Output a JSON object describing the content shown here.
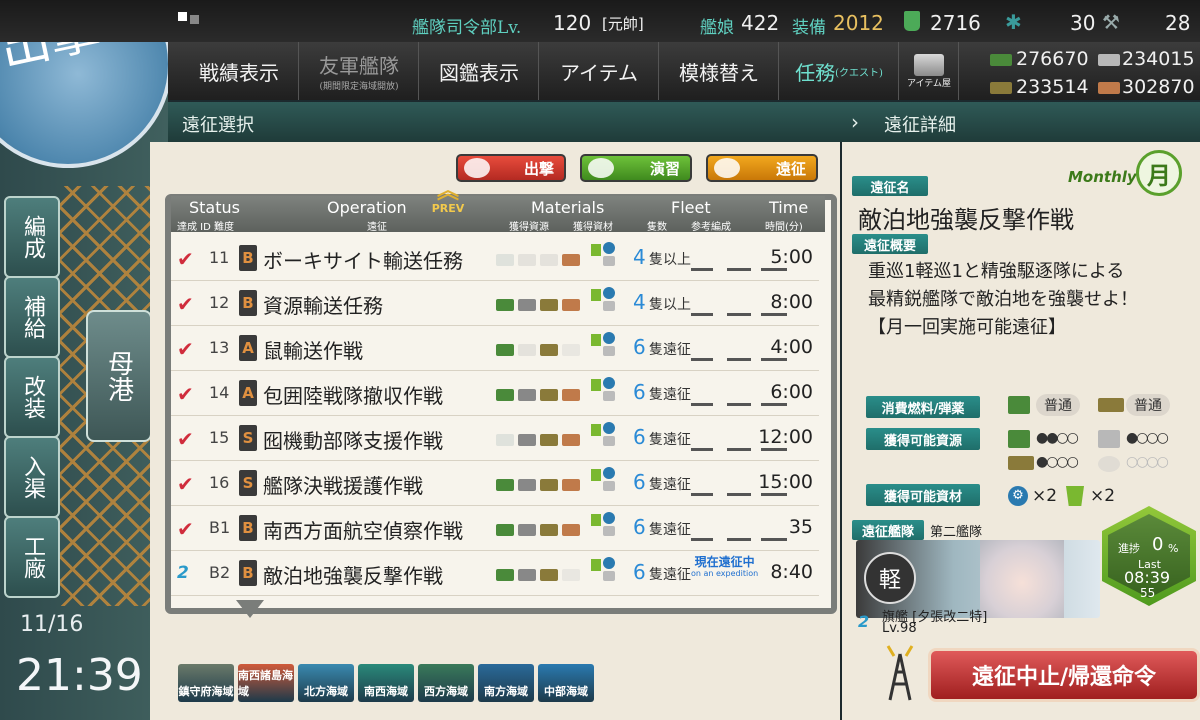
{
  "top": {
    "hq_label": "艦隊司令部Lv.",
    "hq_level": "120",
    "rank": "[元帥]",
    "ships_label": "艦娘",
    "ships": "422",
    "equip_label": "装備",
    "equip": "2012",
    "buckets": "2716",
    "burners": "30",
    "materials": "28"
  },
  "menu": {
    "record": "戦績表示",
    "friend": "友軍艦隊",
    "friend_sub": "(期間限定海域開放)",
    "library": "図鑑表示",
    "items": "アイテム",
    "furniture": "模様替え",
    "quests": "任務",
    "quests_sub": "(クエスト)",
    "shop": "アイテム屋"
  },
  "resources": {
    "fuel": "276670",
    "steel": "234015",
    "ammo": "233514",
    "bauxite": "302870"
  },
  "side": {
    "sortie": "出撃",
    "organize": "編成",
    "supply": "補給",
    "remodel": "改装",
    "dock": "入渠",
    "arsenal": "工廠",
    "port": "母港",
    "date": "11/16",
    "time": "21:39"
  },
  "header": {
    "left": "遠征選択",
    "right": "遠征詳細"
  },
  "top_buttons": {
    "sortie": "出撃",
    "exercise": "演習",
    "expedition": "遠征"
  },
  "table_head": {
    "status": "Status",
    "status_sub": "達成  ID  難度",
    "operation": "Operation",
    "operation_sub": "遠征",
    "prev": "PREV",
    "materials": "Materials",
    "materials_sub1": "獲得資源",
    "materials_sub2": "獲得資材",
    "fleet": "Fleet",
    "fleet_sub1": "隻数",
    "fleet_sub2": "参考編成",
    "time": "Time",
    "time_sub": "時間(分)"
  },
  "rows": [
    {
      "id": "11",
      "diff": "B",
      "name": "ボーキサイト輸送任務",
      "fleet_n": "4",
      "fleet_t": "隻以上",
      "time": "5:00"
    },
    {
      "id": "12",
      "diff": "B",
      "name": "資源輸送任務",
      "fleet_n": "4",
      "fleet_t": "隻以上",
      "time": "8:00"
    },
    {
      "id": "13",
      "diff": "A",
      "name": "鼠輸送作戦",
      "fleet_n": "6",
      "fleet_t": "隻遠征",
      "time": "4:00"
    },
    {
      "id": "14",
      "diff": "A",
      "name": "包囲陸戦隊撤収作戦",
      "fleet_n": "6",
      "fleet_t": "隻遠征",
      "time": "6:00"
    },
    {
      "id": "15",
      "diff": "S",
      "name": "囮機動部隊支援作戦",
      "fleet_n": "6",
      "fleet_t": "隻遠征",
      "time": "12:00"
    },
    {
      "id": "16",
      "diff": "S",
      "name": "艦隊決戦援護作戦",
      "fleet_n": "6",
      "fleet_t": "隻遠征",
      "time": "15:00"
    },
    {
      "id": "B1",
      "diff": "B",
      "name": "南西方面航空偵察作戦",
      "fleet_n": "6",
      "fleet_t": "隻遠征",
      "time": "35"
    },
    {
      "id": "B2",
      "diff": "B",
      "name": "敵泊地強襲反撃作戦",
      "fleet_n": "6",
      "fleet_t": "隻遠征",
      "time": "8:40",
      "note": "現在遠征中",
      "note_en": "on an expedition"
    }
  ],
  "areas": [
    "鎮守府海域",
    "南西諸島海域",
    "北方海域",
    "南西海域",
    "西方海域",
    "南方海域",
    "中部海域"
  ],
  "detail": {
    "name_tag": "遠征名",
    "monthly": "Monthly",
    "month_badge": "月",
    "name": "敵泊地強襲反撃作戦",
    "summary_tag": "遠征概要",
    "desc1": "重巡1軽巡1と精強駆逐隊による",
    "desc2": "最精鋭艦隊で敵泊地を強襲せよ！",
    "desc3": "【月一回実施可能遠征】",
    "consume_tag": "消費燃料/弾薬",
    "consume_fuel": "普通",
    "consume_ammo": "普通",
    "gain_res_tag": "獲得可能資源",
    "gain_item_tag": "獲得可能資材",
    "item1_count": "×2",
    "item2_count": "×2",
    "fleet_tag": "遠征艦隊",
    "fleet_name": "第二艦隊",
    "fleet_kanji": "軽",
    "flagship": "旗艦 [夕張改二特]",
    "flag_level": "Lv.98",
    "progress_label": "進捗",
    "progress": "0",
    "progress_unit": "%",
    "last_label": "Last",
    "last_time": "08:39",
    "last_sec": "55",
    "recall": "遠征中止/帰還命令"
  }
}
